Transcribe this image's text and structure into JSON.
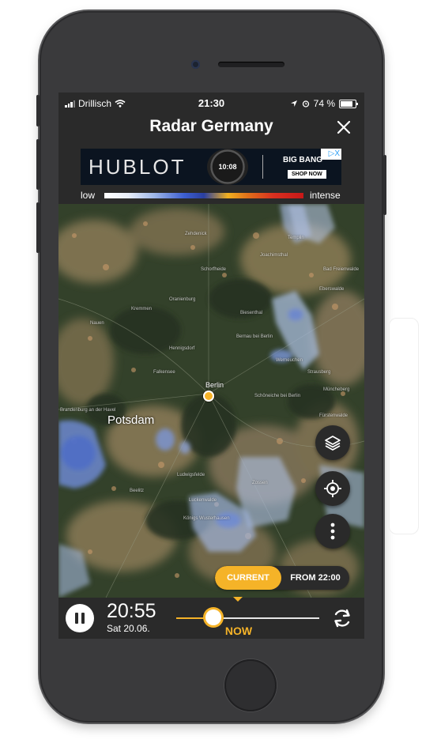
{
  "status_bar": {
    "carrier": "Drillisch",
    "time": "21:30",
    "battery": "74 %"
  },
  "header": {
    "title": "Radar Germany",
    "close_icon": "close-icon"
  },
  "ad": {
    "brand": "HUBLOT",
    "watch_time": "10:08",
    "headline": "BIG BANG",
    "cta": "SHOP NOW",
    "adchoices": "▷X"
  },
  "legend": {
    "low_label": "low",
    "high_label": "intense"
  },
  "map": {
    "cities": {
      "potsdam": "Potsdam",
      "berlin": "Berlin"
    },
    "small_labels": [
      "Oranienburg",
      "Hennigsdorf",
      "Falkensee",
      "Bernau bei Berlin",
      "Joachimsthal",
      "Eberswalde",
      "Schorfheide",
      "Werneuchen",
      "Strausberg",
      "Schöneiche bei Berlin",
      "Müncheberg",
      "Luckenwalde",
      "Zossen",
      "Ludwigsfelde",
      "Königs Wusterhausen",
      "Fürstenwalde",
      "Beelitz",
      "Brandenburg an der Havel",
      "Nauen",
      "Kremmen",
      "Zehdenick",
      "Templin",
      "Biesenthal",
      "Bad Freienwalde"
    ],
    "layers_icon": "layers-icon",
    "locate_icon": "crosshair-icon",
    "more_icon": "more-vertical-icon",
    "marker_icon": "location-dot-icon",
    "toggle": {
      "current": "CURRENT",
      "from": "FROM 22:00"
    }
  },
  "player": {
    "pause_icon": "pause-icon",
    "time": "20:55",
    "date": "Sat 20.06.",
    "now_label": "NOW",
    "progress": 0.26,
    "refresh_icon": "refresh-icon"
  },
  "colors": {
    "accent": "#f5b328",
    "background": "#2a2a2a"
  }
}
